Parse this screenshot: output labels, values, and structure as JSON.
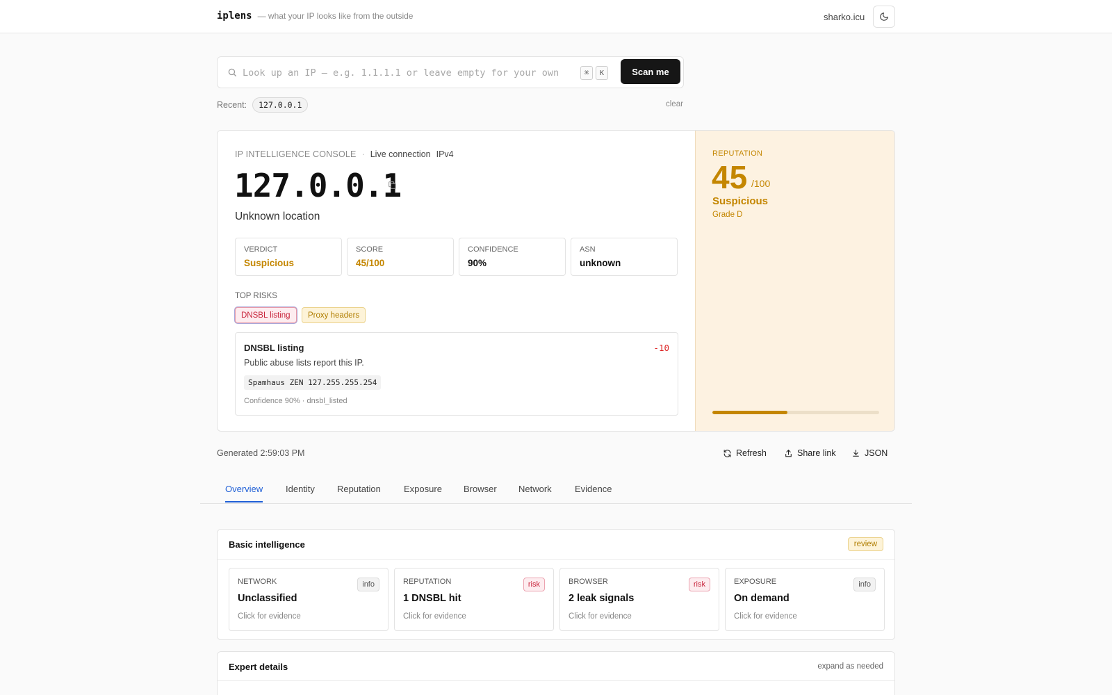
{
  "header": {
    "brand": "iplens",
    "tagline": "— what your IP looks like from the outside",
    "host": "sharko.icu"
  },
  "search": {
    "placeholder": "Look up an IP — e.g. 1.1.1.1 or leave empty for your own",
    "kbd_cmd": "⌘",
    "kbd_key": "K",
    "button": "Scan me"
  },
  "recent": {
    "label": "Recent:",
    "items": [
      "127.0.0.1"
    ],
    "clear": "clear"
  },
  "console": {
    "label": "IP INTELLIGENCE CONSOLE",
    "dot": "·",
    "live": "Live connection",
    "ip_version": "IPv4",
    "ip": "127.0.0.1",
    "location": "Unknown location"
  },
  "stats": [
    {
      "label": "VERDICT",
      "value": "Suspicious"
    },
    {
      "label": "SCORE",
      "value": "45/100"
    },
    {
      "label": "CONFIDENCE",
      "value": "90%"
    },
    {
      "label": "ASN",
      "value": "unknown"
    }
  ],
  "top_risks": {
    "label": "TOP RISKS",
    "chips": [
      "DNSBL listing",
      "Proxy headers"
    ],
    "detail": {
      "title": "DNSBL listing",
      "score": "-10",
      "description": "Public abuse lists report this IP.",
      "code": "Spamhaus ZEN 127.255.255.254",
      "meta": "Confidence 90% · dnsbl_listed"
    }
  },
  "reputation": {
    "label": "REPUTATION",
    "score": "45",
    "max": "/100",
    "verdict": "Suspicious",
    "grade": "Grade D",
    "fill_fraction": 0.45,
    "color": "#c48600"
  },
  "footer_row": {
    "generated": "Generated 2:59:03 PM",
    "refresh": "Refresh",
    "share": "Share link",
    "json": "JSON"
  },
  "tabs": [
    "Overview",
    "Identity",
    "Reputation",
    "Exposure",
    "Browser",
    "Network",
    "Evidence"
  ],
  "basic": {
    "title": "Basic intelligence",
    "badge": "review",
    "cards": [
      {
        "label": "NETWORK",
        "value": "Unclassified",
        "hint": "Click for evidence",
        "badge": "info"
      },
      {
        "label": "REPUTATION",
        "value": "1 DNSBL hit",
        "hint": "Click for evidence",
        "badge": "risk"
      },
      {
        "label": "BROWSER",
        "value": "2 leak signals",
        "hint": "Click for evidence",
        "badge": "risk"
      },
      {
        "label": "EXPOSURE",
        "value": "On demand",
        "hint": "Click for evidence",
        "badge": "info"
      }
    ]
  },
  "expert": {
    "title": "Expert details",
    "note": "expand as needed"
  }
}
